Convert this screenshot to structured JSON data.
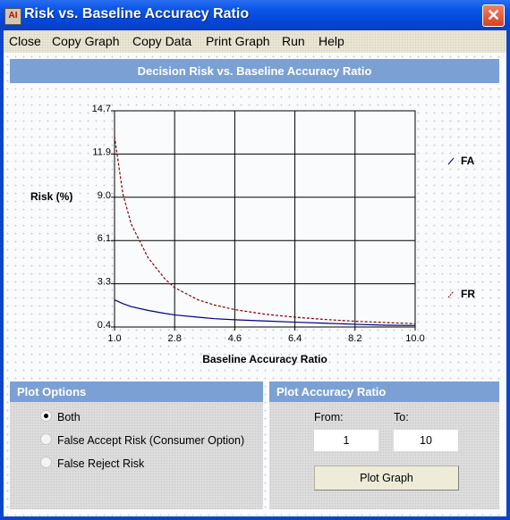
{
  "window": {
    "title": "Risk vs. Baseline Accuracy Ratio",
    "icon": "app-icon",
    "close_icon": "close-icon"
  },
  "menu": [
    "Close",
    "Copy Graph",
    "Copy Data",
    "Print Graph",
    "Run",
    "Help"
  ],
  "chart_header": "Decision Risk vs. Baseline Accuracy Ratio",
  "chart_data": {
    "type": "line",
    "title": "Decision Risk vs. Baseline Accuracy Ratio",
    "xlabel": "Baseline Accuracy Ratio",
    "ylabel": "Risk (%)",
    "xlim": [
      1.0,
      10.0
    ],
    "ylim": [
      0.4,
      14.7
    ],
    "xticks": [
      "1.0",
      "2.8",
      "4.6",
      "6.4",
      "8.2",
      "10.0"
    ],
    "yticks": [
      "0.4",
      "3.3",
      "6.1",
      "9.0",
      "11.9",
      "14.7"
    ],
    "grid": true,
    "legend_position": "right",
    "x": [
      1.0,
      1.25,
      1.5,
      2.0,
      2.5,
      2.8,
      3.5,
      4.0,
      4.6,
      5.5,
      6.4,
      7.3,
      8.2,
      9.1,
      10.0
    ],
    "series": [
      {
        "name": "FA",
        "color": "#000080",
        "style": "solid",
        "values": [
          2.2,
          1.95,
          1.75,
          1.5,
          1.3,
          1.2,
          1.05,
          0.95,
          0.88,
          0.8,
          0.72,
          0.65,
          0.58,
          0.52,
          0.5
        ]
      },
      {
        "name": "FR",
        "color": "#800000",
        "style": "dashed",
        "values": [
          13.0,
          9.2,
          7.2,
          5.0,
          3.6,
          3.0,
          2.2,
          1.85,
          1.55,
          1.25,
          1.05,
          0.9,
          0.78,
          0.7,
          0.62
        ]
      }
    ]
  },
  "plot_options": {
    "title": "Plot Options",
    "options": [
      {
        "label": "Both",
        "selected": true
      },
      {
        "label": "False Accept Risk (Consumer Option)",
        "selected": false
      },
      {
        "label": "False Reject Risk",
        "selected": false
      }
    ]
  },
  "plot_range": {
    "title": "Plot Accuracy Ratio",
    "from_label": "From:",
    "to_label": "To:",
    "from_value": "1",
    "to_value": "10",
    "button_label": "Plot Graph"
  }
}
